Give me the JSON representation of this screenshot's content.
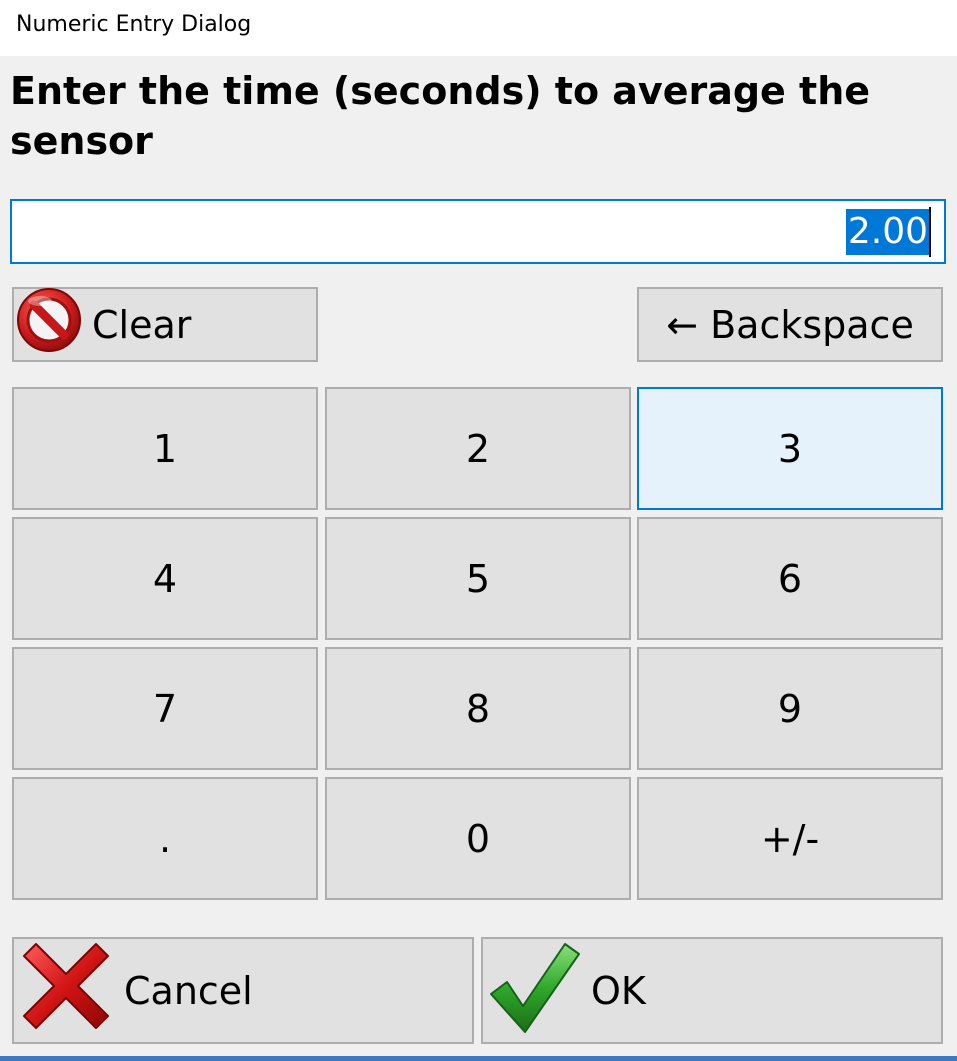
{
  "window": {
    "title": "Numeric Entry Dialog"
  },
  "prompt": "Enter the time (seconds) to average the sensor",
  "entry": {
    "value": "2.00"
  },
  "buttons": {
    "clear": "Clear",
    "backspace": "← Backspace",
    "cancel": "Cancel",
    "ok": "OK"
  },
  "keypad": {
    "k1": "1",
    "k2": "2",
    "k3": "3",
    "k4": "4",
    "k5": "5",
    "k6": "6",
    "k7": "7",
    "k8": "8",
    "k9": "9",
    "kdot": ".",
    "k0": "0",
    "ksign": "+/-"
  },
  "icons": {
    "clear": "no-entry-icon",
    "cancel": "red-x-icon",
    "ok": "green-check-icon"
  },
  "colors": {
    "accent": "#0078d7",
    "button_face": "#e1e1e1",
    "focused_face": "#e5f1fb",
    "clear_icon": "#c8171b",
    "cancel_icon": "#cc1010",
    "ok_icon": "#2fa82a"
  }
}
